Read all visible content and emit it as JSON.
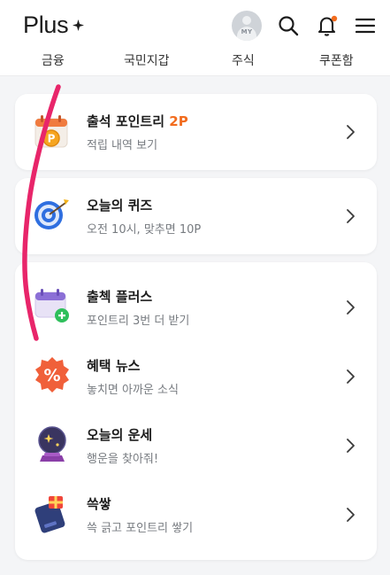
{
  "header": {
    "logo_text": "Plus",
    "avatar_label": "MY",
    "notification_dot_color": "#f26c1e"
  },
  "tabs": [
    {
      "label": "금융"
    },
    {
      "label": "국민지갑"
    },
    {
      "label": "주식"
    },
    {
      "label": "쿠폰함"
    }
  ],
  "cards": {
    "attendance": {
      "title": "출석 포인트리",
      "title_accent": "2P",
      "subtitle": "적립 내역 보기",
      "icon": "calendar-coin-icon"
    },
    "quiz": {
      "title": "오늘의 퀴즈",
      "subtitle": "오전 10시, 맞추면 10P",
      "icon": "dart-target-icon"
    },
    "list": [
      {
        "title": "출첵 플러스",
        "subtitle": "포인트리 3번 더 받기",
        "icon": "calendar-plus-icon"
      },
      {
        "title": "혜택 뉴스",
        "subtitle": "놓치면 아까운 소식",
        "icon": "percent-badge-icon"
      },
      {
        "title": "오늘의 운세",
        "subtitle": "행운을 찾아줘!",
        "icon": "crystal-ball-icon"
      },
      {
        "title": "쓱쌓",
        "subtitle": "쓱 긁고 포인트리 쌓기",
        "icon": "card-gift-icon"
      }
    ]
  },
  "colors": {
    "accent": "#f26c1e",
    "annotation_stroke": "#e8256a"
  }
}
